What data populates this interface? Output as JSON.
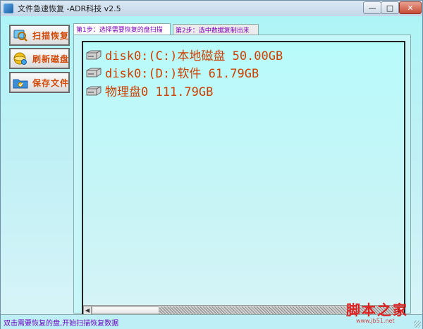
{
  "window": {
    "title": "文件急速恢复  -ADR科技 v2.5"
  },
  "window_controls": {
    "minimize": "—",
    "maximize": "□",
    "close": "✕"
  },
  "sidebar": {
    "items": [
      {
        "label": "扫描恢复",
        "icon": "scan-icon"
      },
      {
        "label": "刷新磁盘",
        "icon": "refresh-disk-icon"
      },
      {
        "label": "保存文件",
        "icon": "save-file-icon"
      }
    ]
  },
  "tabs": [
    {
      "label": "第1步：选择需要恢复的盘扫描",
      "active": true
    },
    {
      "label": "第2步：选中数据复制出来",
      "active": false
    }
  ],
  "disk_list": [
    {
      "label": "disk0:(C:)本地磁盘 50.00GB",
      "icon": "hard-disk-icon"
    },
    {
      "label": "disk0:(D:)软件 61.79GB",
      "icon": "hard-disk-icon"
    },
    {
      "label": "物理盘0 111.79GB",
      "icon": "hard-disk-icon"
    }
  ],
  "scrollbar": {
    "left_arrow": "◀",
    "right_arrow": "▶"
  },
  "status": {
    "text": "双击需要恢复的盘,开始扫描恢复数据"
  },
  "watermark": {
    "main": "脚本之家",
    "sub": "www.jb51.net"
  },
  "colors": {
    "accent_text": "#cc3f00",
    "tab_text": "#7a00b8",
    "background": "#bfeff6"
  }
}
